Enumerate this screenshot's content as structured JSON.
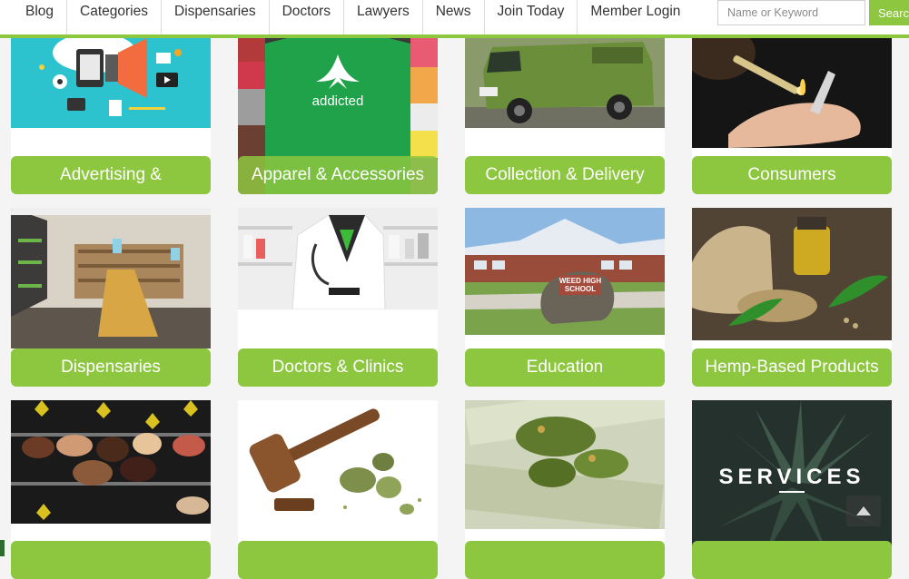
{
  "nav": {
    "items": [
      {
        "label": "Blog"
      },
      {
        "label": "Categories"
      },
      {
        "label": "Dispensaries"
      },
      {
        "label": "Doctors"
      },
      {
        "label": "Lawyers"
      },
      {
        "label": "News"
      },
      {
        "label": "Join Today"
      },
      {
        "label": "Member Login"
      }
    ],
    "search_placeholder": "Name or Keyword",
    "search_button": "Search"
  },
  "categories": [
    {
      "label": "Advertising &"
    },
    {
      "label": "Apparel & Accessories"
    },
    {
      "label": "Collection & Delivery"
    },
    {
      "label": "Consumers"
    },
    {
      "label": "Dispensaries"
    },
    {
      "label": "Doctors & Clinics"
    },
    {
      "label": "Education"
    },
    {
      "label": "Hemp-Based Products"
    },
    {
      "label": ""
    },
    {
      "label": ""
    },
    {
      "label": ""
    },
    {
      "label": ""
    }
  ],
  "images": {
    "tshirt_text": "addicted",
    "school_sign": "WEED HIGH\nSCHOOL",
    "services_text": "SERVICES"
  },
  "colors": {
    "accent": "#8dc63f",
    "nav_bg": "#ffffff",
    "page_bg": "#f4f4f4"
  }
}
